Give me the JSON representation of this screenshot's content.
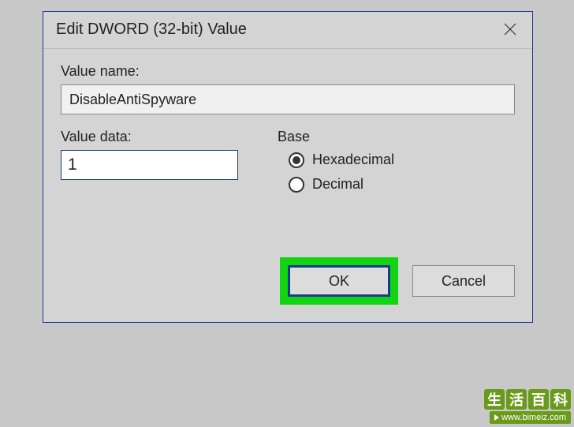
{
  "dialog": {
    "title": "Edit DWORD (32-bit) Value",
    "valueNameLabel": "Value name:",
    "valueName": "DisableAntiSpyware",
    "valueDataLabel": "Value data:",
    "valueData": "1",
    "baseLabel": "Base",
    "radios": {
      "hex": "Hexadecimal",
      "dec": "Decimal"
    },
    "buttons": {
      "ok": "OK",
      "cancel": "Cancel"
    }
  },
  "watermark": {
    "chars": [
      "生",
      "活",
      "百",
      "科"
    ],
    "url": "www.bimeiz.com"
  }
}
